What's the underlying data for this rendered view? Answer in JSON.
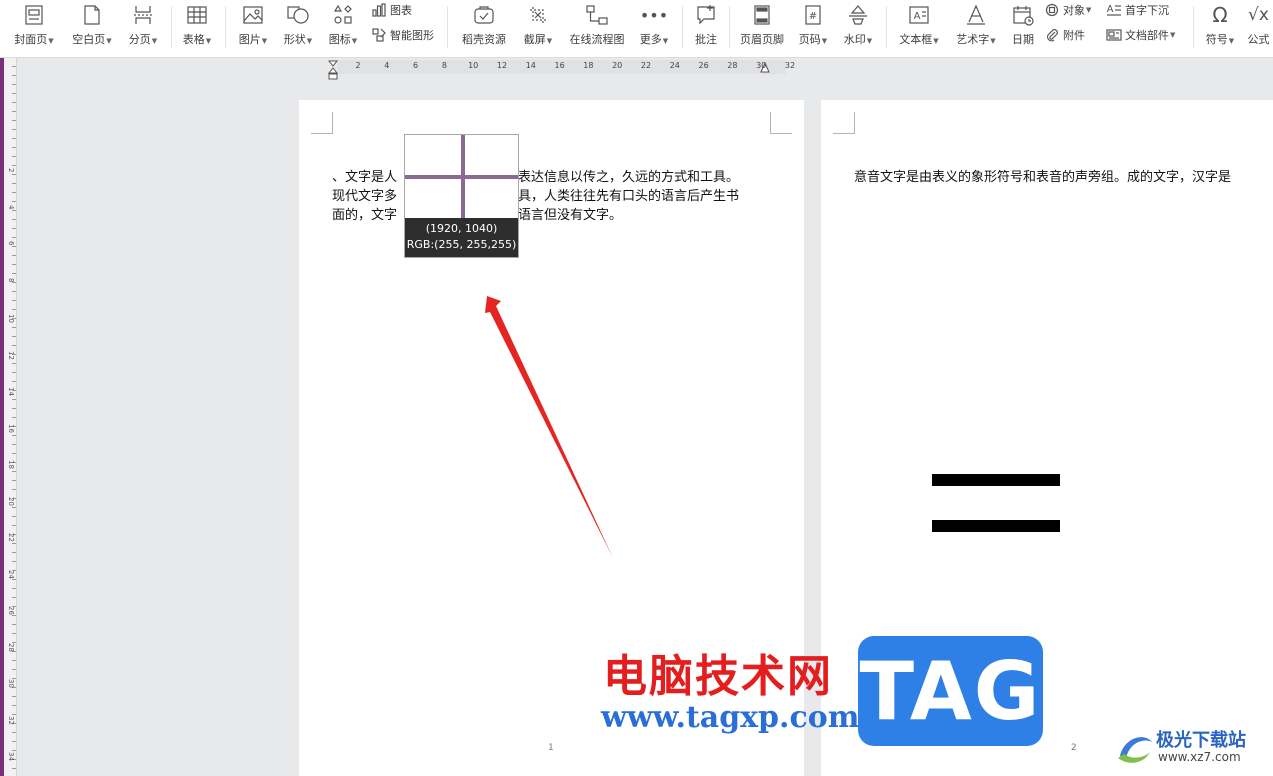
{
  "toolbar": {
    "cover_page": "封面页",
    "blank_page": "空白页",
    "page_break": "分页",
    "table": "表格",
    "picture": "图片",
    "shape": "形状",
    "icon": "图标",
    "chart": "图表",
    "smart_graphic": "智能图形",
    "resources": "稻壳资源",
    "screenshot": "截屏",
    "online_flowchart": "在线流程图",
    "more": "更多",
    "comment": "批注",
    "header_footer": "页眉页脚",
    "page_number": "页码",
    "watermark": "水印",
    "text_box": "文本框",
    "word_art": "艺术字",
    "date": "日期",
    "object": "对象",
    "attachment": "附件",
    "drop_cap": "首字下沉",
    "doc_parts": "文档部件",
    "symbol": "符号",
    "formula": "公式"
  },
  "ruler": {
    "horizontal": [
      "2",
      "4",
      "6",
      "8",
      "10",
      "12",
      "14",
      "16",
      "18",
      "20",
      "22",
      "24",
      "26",
      "28",
      "30",
      "32"
    ],
    "vertical": [
      "2",
      "4",
      "6",
      "8",
      "10",
      "12",
      "14",
      "16",
      "18",
      "20",
      "22",
      "24",
      "26",
      "28",
      "30",
      "32",
      "34"
    ]
  },
  "page1": {
    "line1_left": "、文字是人",
    "line1_right": "表达信息以传之，久远的方式和工具。",
    "line2_left": "现代文字多",
    "line2_right": "具，人类往往先有口头的语言后产生书",
    "line3_left": "面的，文字",
    "line3_right": "语言但没有文字。",
    "page_number": "1"
  },
  "page2": {
    "line1": "意音文字是由表义的象形符号和表音的声旁组。成的文字，汉字是",
    "page_number": "2"
  },
  "magnifier": {
    "coords": "(1920, 1040)",
    "rgb": "RGB:(255, 255,255)"
  },
  "watermarks": {
    "site_cn": "电脑技术网",
    "site_url": "www.tagxp.com",
    "tag_logo": "TAG",
    "download_site": "极光下载站",
    "download_url": "www.xz7.com"
  },
  "colors": {
    "accent_purple": "#7a2f78",
    "arrow_red": "#e52521",
    "crosshair": "#8a6a94",
    "tag_blue": "#2f80e6"
  }
}
